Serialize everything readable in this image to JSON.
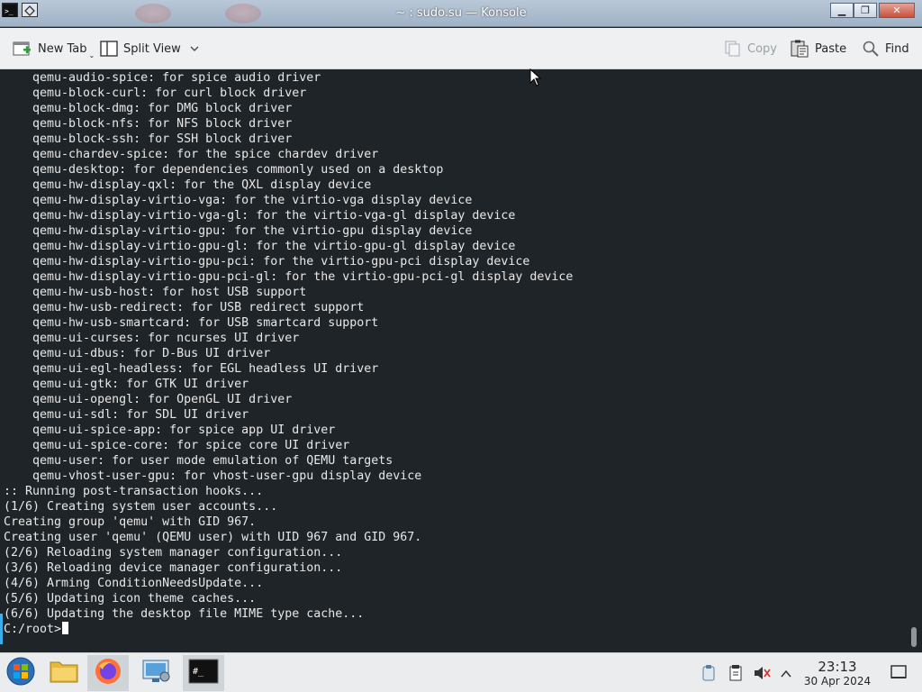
{
  "window": {
    "title": "~ : sudo.su — Konsole",
    "controls": [
      "minimize",
      "maximize",
      "close"
    ]
  },
  "toolbar": {
    "new_tab_label": "New Tab",
    "split_view_label": "Split View",
    "copy_label": "Copy",
    "paste_label": "Paste",
    "find_label": "Find"
  },
  "terminal": {
    "lines": [
      "    qemu-audio-spice: for spice audio driver",
      "    qemu-block-curl: for curl block driver",
      "    qemu-block-dmg: for DMG block driver",
      "    qemu-block-nfs: for NFS block driver",
      "    qemu-block-ssh: for SSH block driver",
      "    qemu-chardev-spice: for the spice chardev driver",
      "    qemu-desktop: for dependencies commonly used on a desktop",
      "    qemu-hw-display-qxl: for the QXL display device",
      "    qemu-hw-display-virtio-vga: for the virtio-vga display device",
      "    qemu-hw-display-virtio-vga-gl: for the virtio-vga-gl display device",
      "    qemu-hw-display-virtio-gpu: for the virtio-gpu display device",
      "    qemu-hw-display-virtio-gpu-gl: for the virtio-gpu-gl display device",
      "    qemu-hw-display-virtio-gpu-pci: for the virtio-gpu-pci display device",
      "    qemu-hw-display-virtio-gpu-pci-gl: for the virtio-gpu-pci-gl display device",
      "    qemu-hw-usb-host: for host USB support",
      "    qemu-hw-usb-redirect: for USB redirect support",
      "    qemu-hw-usb-smartcard: for USB smartcard support",
      "    qemu-ui-curses: for ncurses UI driver",
      "    qemu-ui-dbus: for D-Bus UI driver",
      "    qemu-ui-egl-headless: for EGL headless UI driver",
      "    qemu-ui-gtk: for GTK UI driver",
      "    qemu-ui-opengl: for OpenGL UI driver",
      "    qemu-ui-sdl: for SDL UI driver",
      "    qemu-ui-spice-app: for spice app UI driver",
      "    qemu-ui-spice-core: for spice core UI driver",
      "    qemu-user: for user mode emulation of QEMU targets",
      "    qemu-vhost-user-gpu: for vhost-user-gpu display device",
      ":: Running post-transaction hooks...",
      "(1/6) Creating system user accounts...",
      "Creating group 'qemu' with GID 967.",
      "Creating user 'qemu' (QEMU user) with UID 967 and GID 967.",
      "(2/6) Reloading system manager configuration...",
      "(3/6) Reloading device manager configuration...",
      "(4/6) Arming ConditionNeedsUpdate...",
      "(5/6) Updating icon theme caches...",
      "(6/6) Updating the desktop file MIME type cache..."
    ],
    "prompt": "C:/root>"
  },
  "taskbar": {
    "apps": [
      "start-menu",
      "file-manager",
      "firefox",
      "system-settings",
      "konsole"
    ],
    "clock_time": "23:13",
    "clock_date": "30 Apr 2024"
  },
  "colors": {
    "terminal_bg": "#1f2428",
    "terminal_fg": "#e8e8e8",
    "accent": "#3daee9"
  }
}
